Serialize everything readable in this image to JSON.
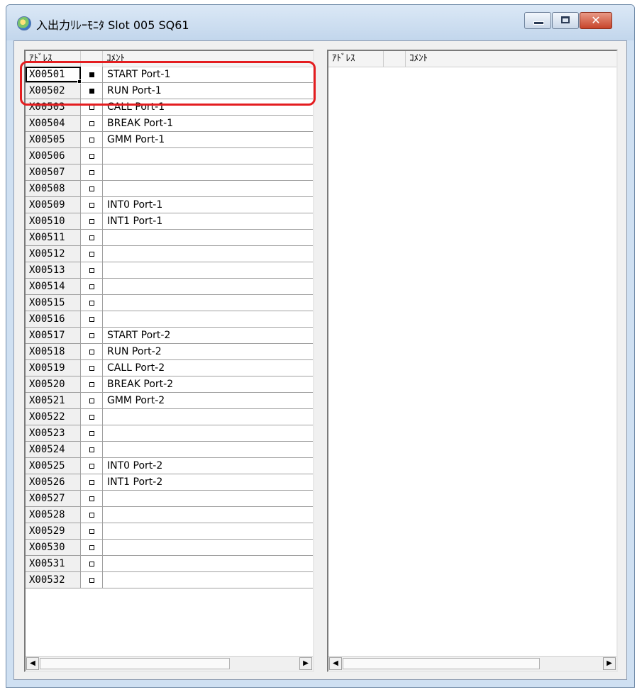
{
  "window": {
    "title": "入出力ﾘﾚｰﾓﾆﾀ Slot 005 SQ61",
    "controls": {
      "minimize": "minimize",
      "maximize": "maximize",
      "close": "✕"
    }
  },
  "left_pane": {
    "headers": {
      "address": "ｱﾄﾞﾚｽ",
      "state": "",
      "comment": "ｺﾒﾝﾄ"
    },
    "rows": [
      {
        "address": "X00501",
        "state": "on",
        "comment": "START Port-1"
      },
      {
        "address": "X00502",
        "state": "on",
        "comment": "RUN Port-1"
      },
      {
        "address": "X00503",
        "state": "off",
        "comment": "CALL Port-1"
      },
      {
        "address": "X00504",
        "state": "off",
        "comment": "BREAK Port-1"
      },
      {
        "address": "X00505",
        "state": "off",
        "comment": "GMM Port-1"
      },
      {
        "address": "X00506",
        "state": "off",
        "comment": ""
      },
      {
        "address": "X00507",
        "state": "off",
        "comment": ""
      },
      {
        "address": "X00508",
        "state": "off",
        "comment": ""
      },
      {
        "address": "X00509",
        "state": "off",
        "comment": "INT0 Port-1"
      },
      {
        "address": "X00510",
        "state": "off",
        "comment": "INT1 Port-1"
      },
      {
        "address": "X00511",
        "state": "off",
        "comment": ""
      },
      {
        "address": "X00512",
        "state": "off",
        "comment": ""
      },
      {
        "address": "X00513",
        "state": "off",
        "comment": ""
      },
      {
        "address": "X00514",
        "state": "off",
        "comment": ""
      },
      {
        "address": "X00515",
        "state": "off",
        "comment": ""
      },
      {
        "address": "X00516",
        "state": "off",
        "comment": ""
      },
      {
        "address": "X00517",
        "state": "off",
        "comment": "START Port-2"
      },
      {
        "address": "X00518",
        "state": "off",
        "comment": "RUN Port-2"
      },
      {
        "address": "X00519",
        "state": "off",
        "comment": "CALL Port-2"
      },
      {
        "address": "X00520",
        "state": "off",
        "comment": "BREAK Port-2"
      },
      {
        "address": "X00521",
        "state": "off",
        "comment": "GMM Port-2"
      },
      {
        "address": "X00522",
        "state": "off",
        "comment": ""
      },
      {
        "address": "X00523",
        "state": "off",
        "comment": ""
      },
      {
        "address": "X00524",
        "state": "off",
        "comment": ""
      },
      {
        "address": "X00525",
        "state": "off",
        "comment": "INT0 Port-2"
      },
      {
        "address": "X00526",
        "state": "off",
        "comment": "INT1 Port-2"
      },
      {
        "address": "X00527",
        "state": "off",
        "comment": ""
      },
      {
        "address": "X00528",
        "state": "off",
        "comment": ""
      },
      {
        "address": "X00529",
        "state": "off",
        "comment": ""
      },
      {
        "address": "X00530",
        "state": "off",
        "comment": ""
      },
      {
        "address": "X00531",
        "state": "off",
        "comment": ""
      },
      {
        "address": "X00532",
        "state": "off",
        "comment": ""
      }
    ],
    "selected_index": 0,
    "scroll": {
      "left_arrow": "◀",
      "right_arrow": "▶"
    }
  },
  "right_pane": {
    "headers": {
      "address": "ｱﾄﾞﾚｽ",
      "state": "",
      "comment": "ｺﾒﾝﾄ"
    },
    "rows": [],
    "scroll": {
      "left_arrow": "◀",
      "right_arrow": "▶"
    }
  },
  "highlight_color": "#e41d20",
  "icons": {
    "app": "io-relay-monitor-icon"
  }
}
